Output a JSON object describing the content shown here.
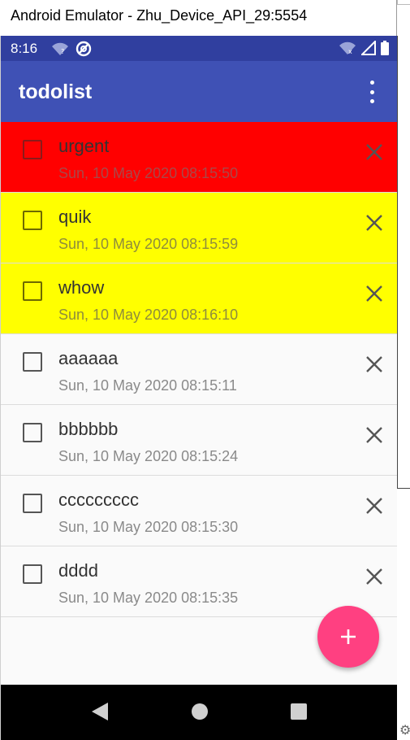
{
  "window": {
    "title": "Android Emulator - Zhu_Device_API_29:5554"
  },
  "status_bar": {
    "time": "8:16",
    "left_icons": [
      "wifi-question-icon",
      "no-signal-icon"
    ],
    "right_icons": [
      "wifi-icon",
      "cell-signal-icon",
      "battery-icon"
    ]
  },
  "app_bar": {
    "title": "todolist",
    "menu_icon": "more-vert-icon"
  },
  "colors": {
    "status_bar": "#303f9f",
    "app_bar": "#3f51b5",
    "urgent_item": "#ff0000",
    "quick_item": "#ffff00",
    "normal_item": "#fafafa",
    "fab": "#ff4081"
  },
  "todos": [
    {
      "title": "urgent",
      "date": "Sun, 10 May 2020 08:15:50",
      "priority": "red",
      "checked": false
    },
    {
      "title": "quik",
      "date": "Sun, 10 May 2020 08:15:59",
      "priority": "yellow",
      "checked": false
    },
    {
      "title": "whow",
      "date": "Sun, 10 May 2020 08:16:10",
      "priority": "yellow",
      "checked": false
    },
    {
      "title": "aaaaaa",
      "date": "Sun, 10 May 2020 08:15:11",
      "priority": "normal",
      "checked": false
    },
    {
      "title": "bbbbbb",
      "date": "Sun, 10 May 2020 08:15:24",
      "priority": "normal",
      "checked": false
    },
    {
      "title": "ccccccccc",
      "date": "Sun, 10 May 2020 08:15:30",
      "priority": "normal",
      "checked": false
    },
    {
      "title": "dddd",
      "date": "Sun, 10 May 2020 08:15:35",
      "priority": "normal",
      "checked": false
    }
  ],
  "fab": {
    "label": "+",
    "icon": "add-icon"
  },
  "nav_bar": {
    "icons": [
      "back-icon",
      "home-icon",
      "recents-icon"
    ]
  }
}
